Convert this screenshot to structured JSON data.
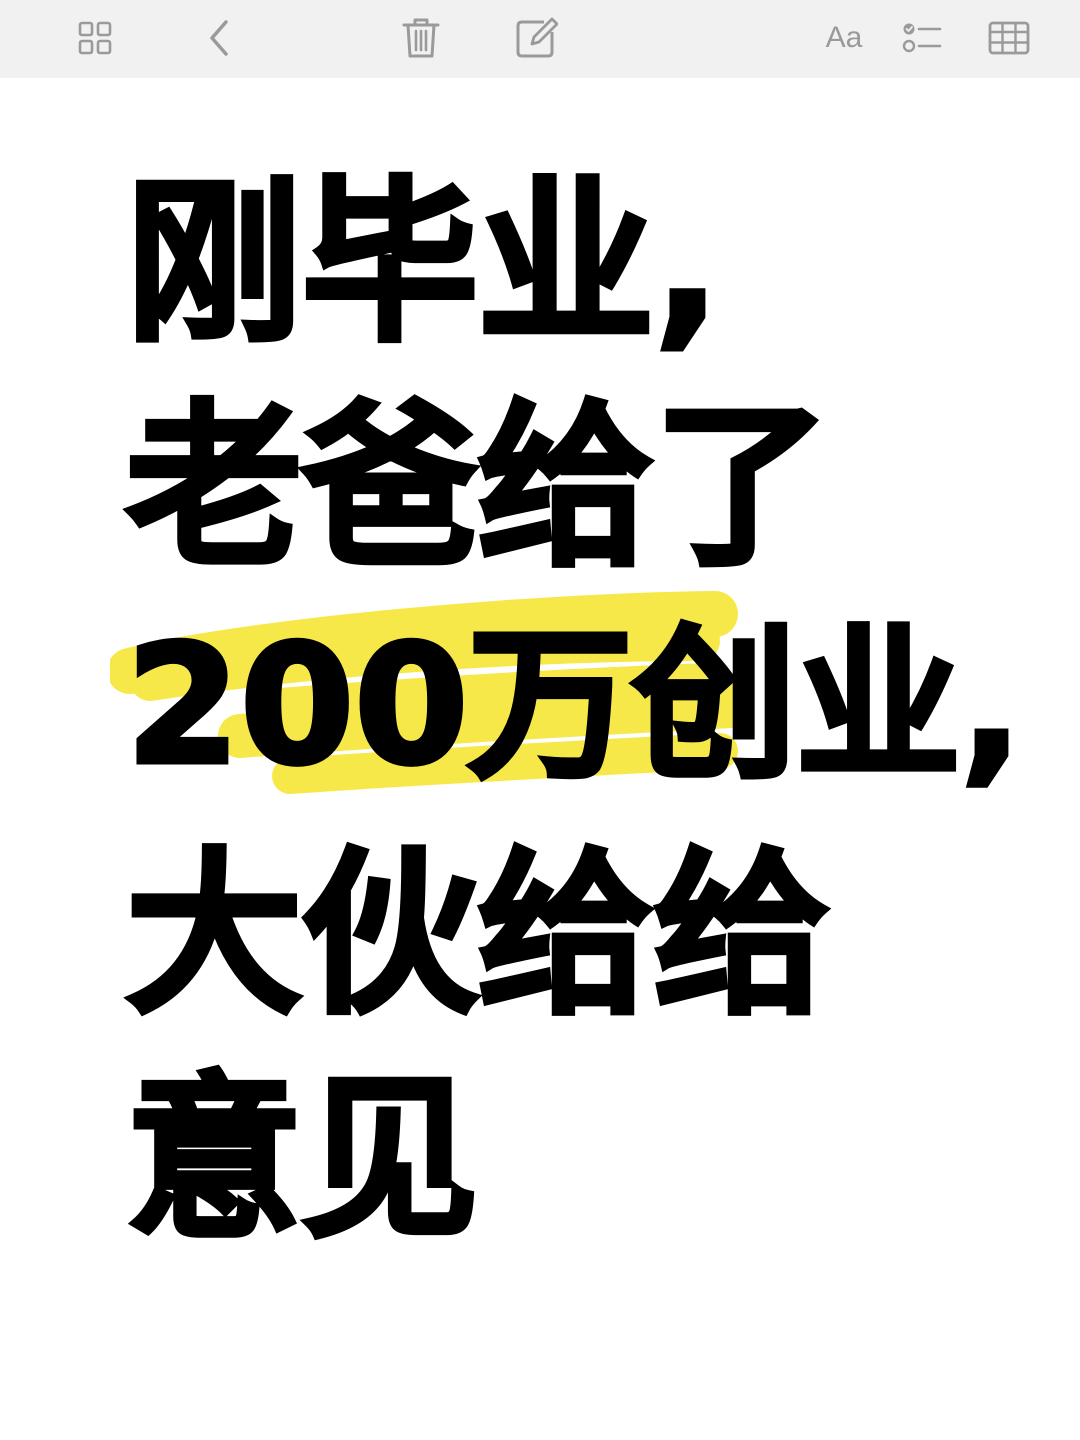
{
  "toolbar": {
    "icons": [
      "grid-icon",
      "back-icon",
      "trash-icon",
      "compose-icon",
      "text-format-icon",
      "checklist-icon",
      "table-icon"
    ],
    "format_label": "Aa"
  },
  "note": {
    "lines": [
      "刚毕业,",
      "老爸给了",
      "200万创业,",
      "大伙给给",
      "意见"
    ],
    "highlight_color": "#f7e84a",
    "highlighted_line": "200万创业,"
  }
}
